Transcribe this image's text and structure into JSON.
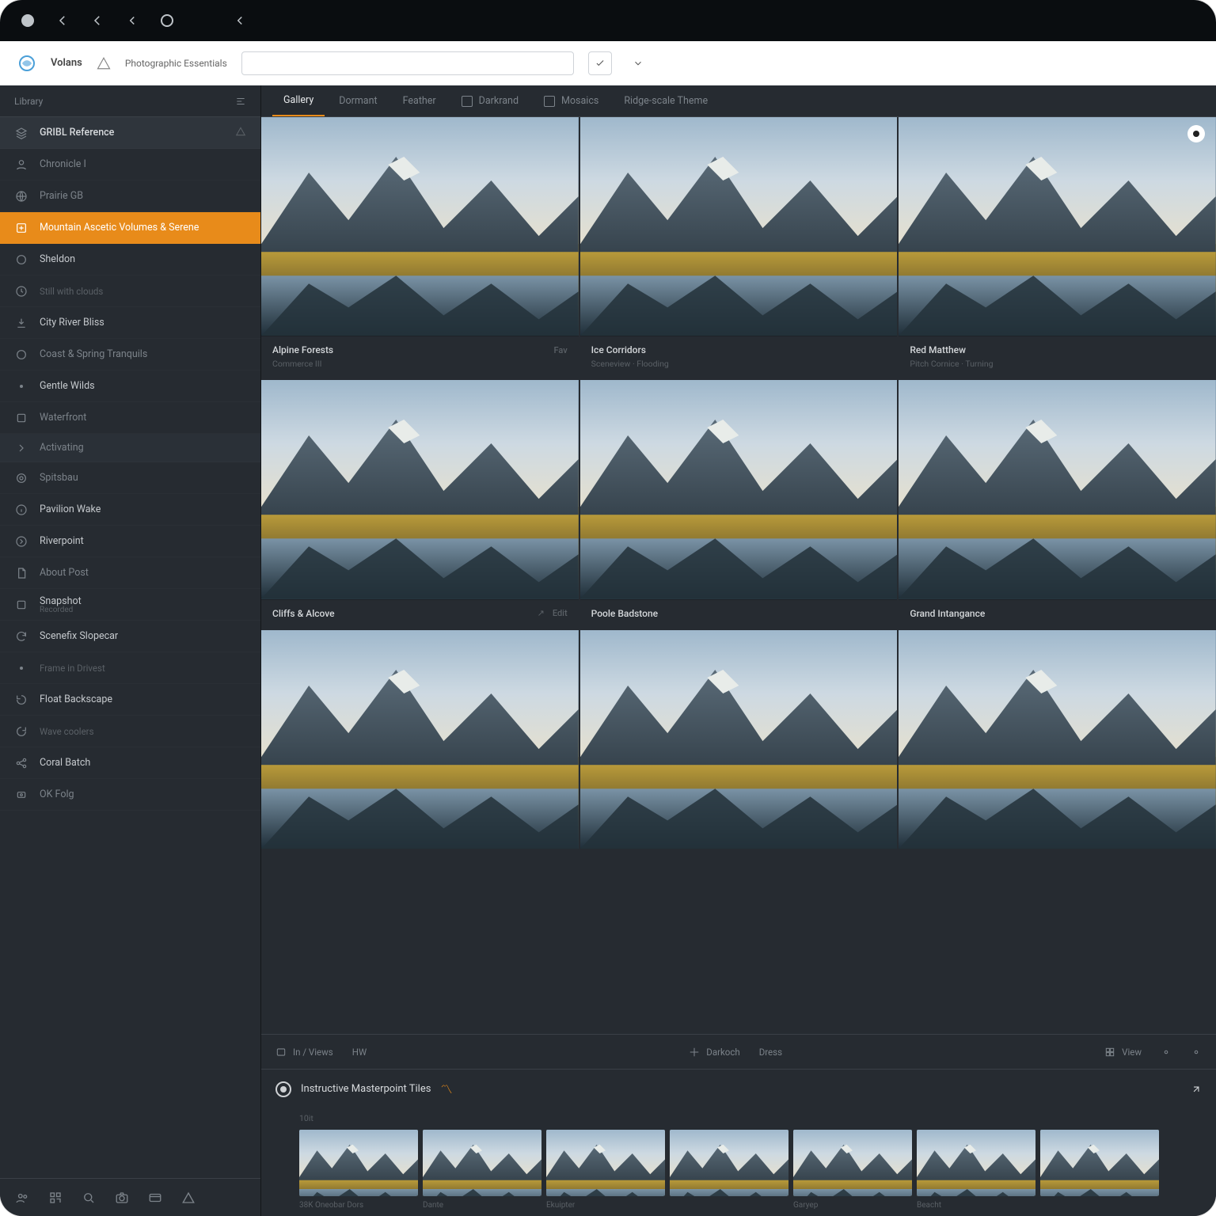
{
  "brand": "Volans",
  "breadcrumb": "Photographic Essentials",
  "search_placeholder": "",
  "sidebar": {
    "header": "Library",
    "items": [
      {
        "label": "GRIBL Reference",
        "kind": "group",
        "icon": "layers"
      },
      {
        "label": "Chronicle I",
        "kind": "dim",
        "icon": "user"
      },
      {
        "label": "Prairie GB",
        "kind": "dim",
        "icon": "globe"
      },
      {
        "label": "Mountain Ascetic Volumes & Serene",
        "kind": "active",
        "icon": "plus-square"
      },
      {
        "label": "Sheldon",
        "kind": "normal",
        "icon": "circle"
      },
      {
        "label": "Still with clouds",
        "kind": "faint",
        "icon": "clock"
      },
      {
        "label": "City River Bliss",
        "kind": "normal",
        "icon": "download"
      },
      {
        "label": "Coast & Spring Tranquils",
        "kind": "dim",
        "icon": "circle"
      },
      {
        "label": "Gentle Wilds",
        "kind": "normal",
        "icon": "dot"
      },
      {
        "label": "Waterfront",
        "kind": "dim",
        "icon": "square"
      },
      {
        "label": "Activating",
        "kind": "section",
        "icon": "chevron"
      },
      {
        "label": "Spitsbau",
        "kind": "dim",
        "icon": "target"
      },
      {
        "label": "Pavilion Wake",
        "kind": "normal",
        "icon": "info"
      },
      {
        "label": "Riverpoint",
        "kind": "normal",
        "icon": "arrow-right-circle"
      },
      {
        "label": "About Post",
        "kind": "dim",
        "icon": "file"
      },
      {
        "label": "Snapshot",
        "kind": "normal-sub",
        "icon": "square",
        "sub": "Recorded"
      },
      {
        "label": "Scenefix Slopecar",
        "kind": "normal",
        "icon": "refresh"
      },
      {
        "label": "Frame in Drivest",
        "kind": "faint",
        "icon": "dot"
      },
      {
        "label": "Float Backscape",
        "kind": "normal",
        "icon": "rotate",
        "tail": "square"
      },
      {
        "label": "Wave coolers",
        "kind": "faint",
        "icon": "rotate-ccw"
      },
      {
        "label": "Coral Batch",
        "kind": "normal",
        "icon": "share"
      },
      {
        "label": "OK Folg",
        "kind": "dim",
        "icon": "badge"
      }
    ],
    "footer_icons": [
      "users",
      "qr",
      "search",
      "camera",
      "card",
      "triangle"
    ]
  },
  "tabs": [
    {
      "label": "Gallery",
      "active": true
    },
    {
      "label": "Dormant"
    },
    {
      "label": "Feather"
    },
    {
      "label": "Darkrand",
      "icon": true
    },
    {
      "label": "Mosaics",
      "icon": true
    },
    {
      "label": "Ridge-scale Theme"
    }
  ],
  "grid": {
    "rows": [
      {
        "thumbs": [
          {
            "title": "Alpine Forests",
            "sub": "Commerce III",
            "actions": [
              "Fav",
              ""
            ]
          },
          {
            "title": "Ice Corridors",
            "sub": "Sceneview · Flooding",
            "actions": []
          },
          {
            "title": "Red Matthew",
            "sub": "Pitch Cornice · Turning",
            "actions": [],
            "marker": true
          }
        ]
      },
      {
        "thumbs": [
          {
            "title": "Cliffs & Alcove",
            "sub": "",
            "actions": [
              "↗",
              "Edit"
            ]
          },
          {
            "title": "Poole Badstone",
            "sub": "",
            "actions": []
          },
          {
            "title": "Grand Intangance",
            "sub": "",
            "actions": []
          }
        ]
      },
      {
        "thumbs": [
          {
            "title": "",
            "sub": "",
            "actions": []
          },
          {
            "title": "",
            "sub": "",
            "actions": []
          },
          {
            "title": "",
            "sub": "",
            "actions": []
          }
        ]
      }
    ]
  },
  "meta": {
    "left1": "In / Views",
    "left2": "HW",
    "right": [
      "Darkoch",
      "Dress",
      "View",
      "·",
      "·"
    ]
  },
  "panel": {
    "title": "Instructive Masterpoint Tiles",
    "strip_header": "10it",
    "strip": [
      {
        "label": "38K Oneobar Dors"
      },
      {
        "label": "Dante"
      },
      {
        "label": "Ekuipter"
      },
      {
        "label": ""
      },
      {
        "label": "Garyep"
      },
      {
        "label": "Beacht"
      },
      {
        "label": ""
      }
    ]
  }
}
